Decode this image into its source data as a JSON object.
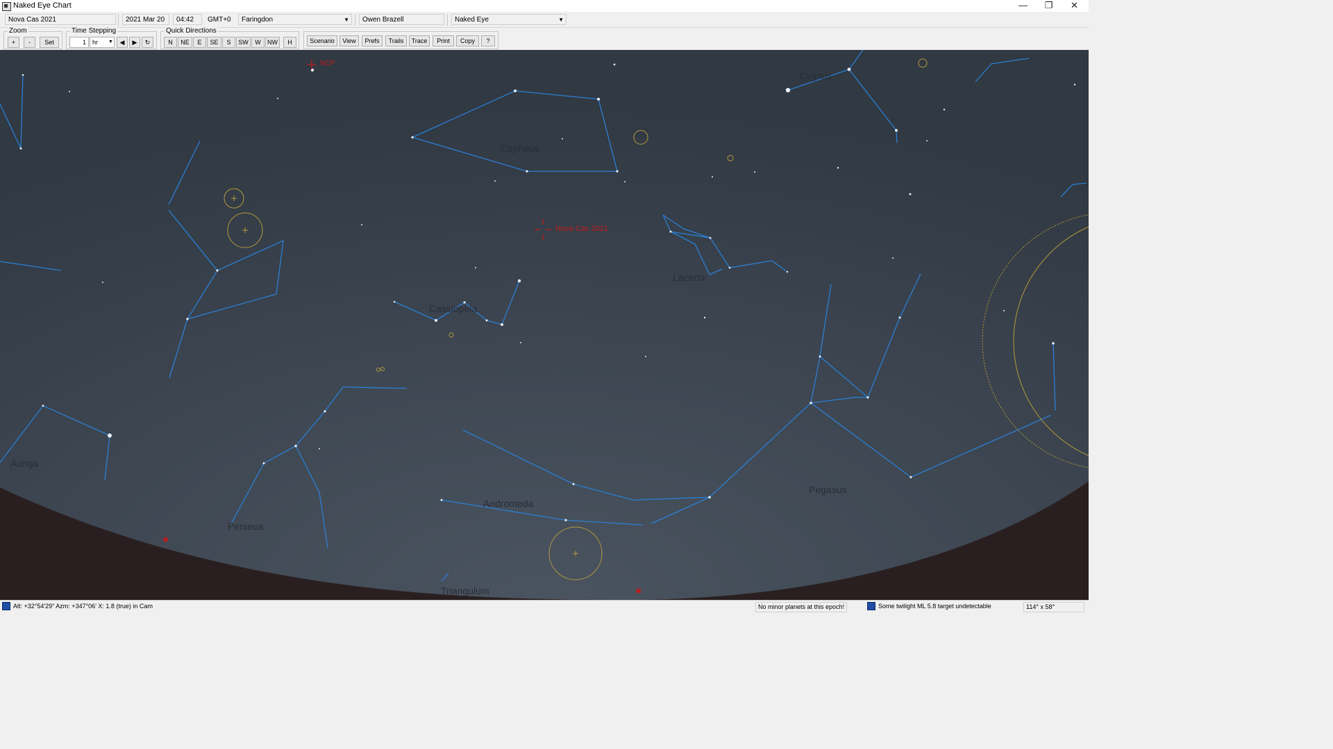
{
  "window": {
    "title": "Naked Eye Chart",
    "controls": [
      "—",
      "❐",
      "✕"
    ]
  },
  "toprow": {
    "scenario_name": "Nova Cas 2021",
    "date": "2021 Mar 20",
    "time": "04:42",
    "timezone": "GMT+0",
    "location": "Faringdon",
    "observer": "Owen Brazell",
    "view_mode": "Naked Eye"
  },
  "zoom": {
    "label": "Zoom",
    "plus": "+",
    "minus": "-",
    "set": "Set"
  },
  "timestep": {
    "label": "Time Stepping",
    "amount": "1",
    "unit": "hr",
    "back": "◀",
    "fwd": "▶",
    "reset": "↻"
  },
  "quickdir": {
    "label": "Quick Directions",
    "dirs": [
      "N",
      "NE",
      "E",
      "SE",
      "S",
      "SW",
      "W",
      "NW"
    ],
    "h": "H"
  },
  "actions": [
    "Scenario",
    "View",
    "Prefs",
    "Trails",
    "Trace",
    "Print",
    "Copy",
    "?"
  ],
  "sky": {
    "colors": {
      "sky": "#323a45",
      "horizon": "#2a1f20",
      "lines": "#2b7fd4",
      "dso": "#b59a3a",
      "marker": "#c21a1a",
      "label": "#22262c"
    },
    "labels": {
      "ncp": "NCP",
      "nova": "Nova Cas 2021",
      "cepheus": "Cepheus",
      "cassiopeia": "Cassiopeia",
      "lacerta": "Lacerta",
      "cygnus": "Cygnus",
      "auriga": "Auriga",
      "perseus": "Perseus",
      "andromeda": "Andromeda",
      "pegasus": "Pegasus",
      "triangulum": "Triangulum"
    }
  },
  "status": {
    "position": "Alt: +32°54'29\"  Azm: +347°06'  X: 1.8 (true) in Cam",
    "minor_planets": "No minor planets at this epoch!",
    "twilight": "Some twilight ML 5.8 target undetectable",
    "fov": "114° x 58°"
  }
}
